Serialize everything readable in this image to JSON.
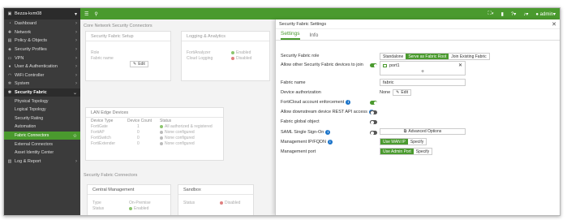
{
  "sidebar": {
    "device_name": "Bezza-kvm08",
    "items": [
      {
        "label": "Dashboard",
        "icon": "dashboard-icon"
      },
      {
        "label": "Network",
        "icon": "network-icon"
      },
      {
        "label": "Policy & Objects",
        "icon": "policy-icon"
      },
      {
        "label": "Security Profiles",
        "icon": "shield-icon"
      },
      {
        "label": "VPN",
        "icon": "vpn-icon"
      },
      {
        "label": "User & Authentication",
        "icon": "user-icon"
      },
      {
        "label": "WiFi Controller",
        "icon": "wifi-icon"
      },
      {
        "label": "System",
        "icon": "gear-icon"
      },
      {
        "label": "Security Fabric",
        "icon": "fabric-icon"
      }
    ],
    "subitems": [
      "Physical Topology",
      "Logical Topology",
      "Security Rating",
      "Automation",
      "Fabric Connectors",
      "External Connectors",
      "Asset Identity Center"
    ],
    "last_item": {
      "label": "Log & Report",
      "icon": "log-icon"
    }
  },
  "topbar": {
    "user": "admin"
  },
  "background": {
    "breadcrumb": "Core Network Security Connectors",
    "security_fabric_setup": {
      "title": "Security Fabric Setup",
      "role_label": "Role",
      "name_label": "Fabric name",
      "edit": "Edit"
    },
    "logging": {
      "title": "Logging & Analytics",
      "row1_label": "FortiAnalyzer",
      "row1_value": "Enabled",
      "row2_label": "Cloud Logging",
      "row2_value": "Disabled"
    },
    "lan_edge": {
      "title": "LAN Edge Devices",
      "headers": [
        "Device Type",
        "Device Count",
        "Status"
      ],
      "rows": [
        {
          "type": "FortiGate",
          "count": "1",
          "status": "All authorized & registered"
        },
        {
          "type": "FortiAP",
          "count": "0",
          "status": "None configured"
        },
        {
          "type": "FortiSwitch",
          "count": "0",
          "status": "None configured"
        },
        {
          "type": "FortiExtender",
          "count": "0",
          "status": "None configured"
        }
      ]
    },
    "section2": "Security Fabric Connectors",
    "central_mgmt": {
      "title": "Central Management",
      "type_label": "Type",
      "type_value": "On-Premise",
      "status_label": "Status",
      "status_value": "Enabled"
    },
    "sandbox": {
      "title": "Sandbox",
      "status_label": "Status",
      "status_value": "Disabled"
    }
  },
  "dialog": {
    "title": "Security Fabric Settings",
    "tabs": [
      "Settings",
      "Info"
    ],
    "fields": {
      "role_label": "Security Fabric role",
      "role_options": [
        "Standalone",
        "Serve as Fabric Root",
        "Join Existing Fabric"
      ],
      "role_selected": "Serve as Fabric Root",
      "allow_join_label": "Allow other Security Fabric devices to join",
      "allow_join_value": "port1",
      "fabric_name_label": "Fabric name",
      "fabric_name_value": "fabric",
      "device_auth_label": "Device authorization",
      "device_auth_value": "None",
      "device_auth_edit": "Edit",
      "forticloud_label": "FortiCloud account enforcement",
      "downstream_label": "Allow downstream device REST API access",
      "global_object_label": "Fabric global object",
      "saml_label": "SAML Single Sign-On",
      "advanced_options": "Advanced Options",
      "mgmt_ip_label": "Management IP/FQDN",
      "mgmt_ip_options": [
        "Use WAN IP",
        "Specify"
      ],
      "mgmt_port_label": "Management port",
      "mgmt_port_options": [
        "Use Admin Port",
        "Specify"
      ]
    }
  },
  "colors": {
    "accent": "#4a9a2e",
    "sidebar_bg": "#3b3b3b",
    "info": "#1a73c9"
  }
}
